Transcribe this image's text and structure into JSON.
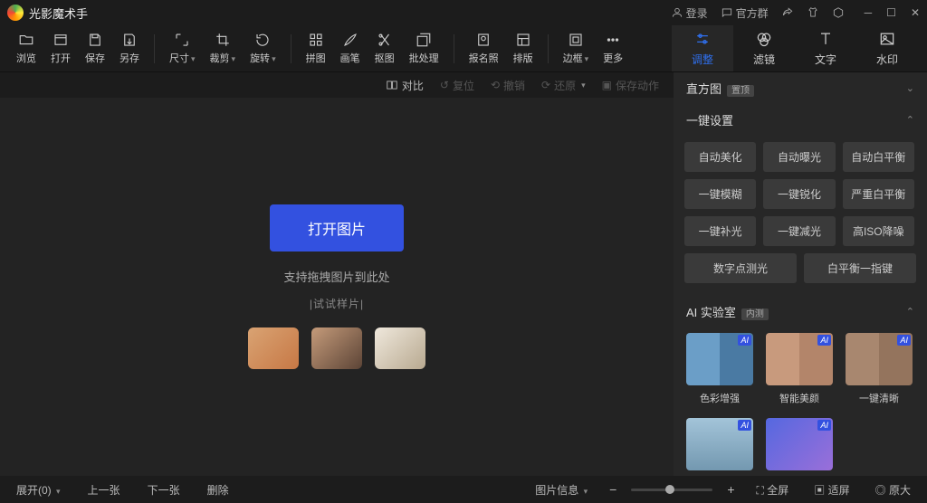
{
  "title": "光影魔术手",
  "header": {
    "login": "登录",
    "group": "官方群"
  },
  "toolbar": {
    "browse": "浏览",
    "open": "打开",
    "save": "保存",
    "saveas": "另存",
    "size": "尺寸",
    "crop": "裁剪",
    "rotate": "旋转",
    "collage": "拼图",
    "brush": "画笔",
    "cutout": "抠图",
    "batch": "批处理",
    "idphoto": "报名照",
    "layout": "排版",
    "frame": "边框",
    "more": "更多"
  },
  "right_tabs": {
    "adjust": "调整",
    "filter": "滤镜",
    "text": "文字",
    "watermark": "水印"
  },
  "secondary": {
    "compare": "对比",
    "revert": "复位",
    "undo": "撤销",
    "redo": "还原",
    "save_action": "保存动作"
  },
  "canvas": {
    "open_btn": "打开图片",
    "drag_hint": "支持拖拽图片到此处",
    "sample_caption": "|试试样片|"
  },
  "panel": {
    "histogram": "直方图",
    "histogram_badge": "置顶",
    "quick": "一键设置",
    "presets": [
      "自动美化",
      "自动曝光",
      "自动白平衡",
      "一键模糊",
      "一键锐化",
      "严重白平衡",
      "一键补光",
      "一键减光",
      "高ISO降噪",
      "数字点测光",
      "白平衡一指键"
    ],
    "ai_lab": "AI 实验室",
    "ai_badge": "内测",
    "ai_items": [
      "色彩增强",
      "智能美颜",
      "一键清晰"
    ]
  },
  "bottom": {
    "expand": "展开(0)",
    "prev": "上一张",
    "next": "下一张",
    "delete": "删除",
    "info": "图片信息",
    "fullscreen": "全屏",
    "fit": "适屏",
    "actual": "原大"
  }
}
